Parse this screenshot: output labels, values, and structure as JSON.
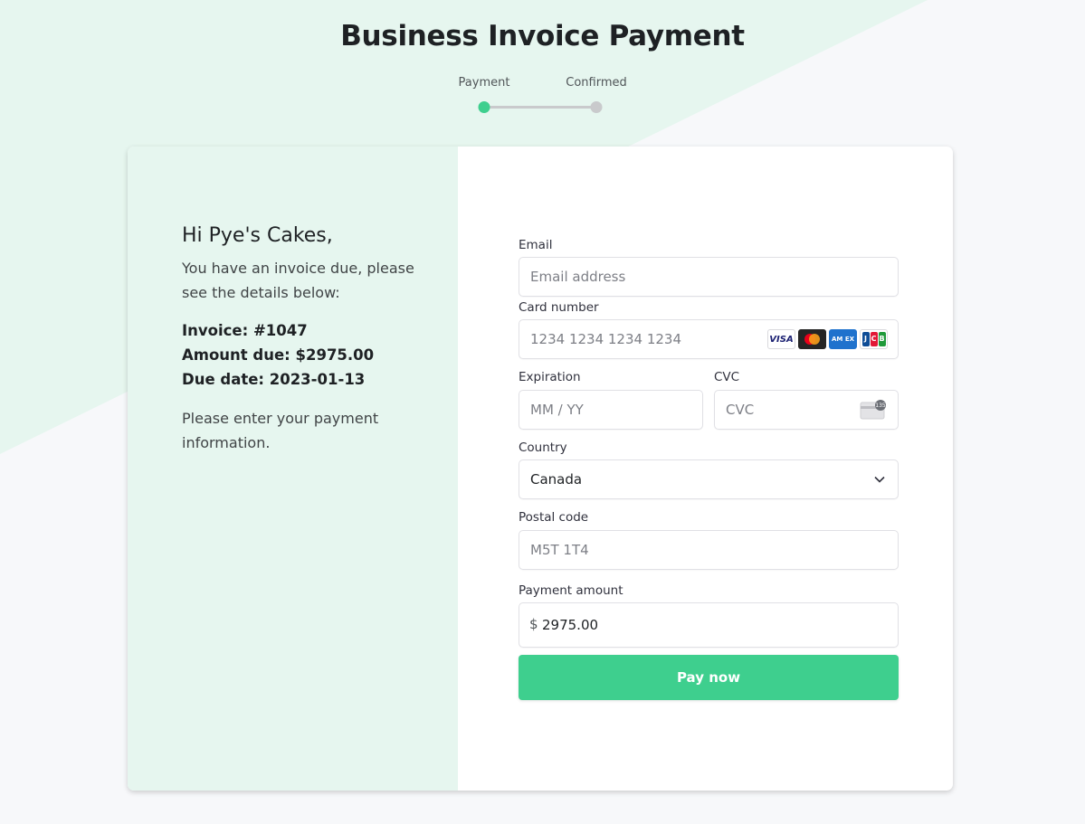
{
  "page": {
    "title": "Business Invoice Payment",
    "accent_color": "#3ecf8e"
  },
  "stepper": {
    "steps": [
      {
        "label": "Payment",
        "state": "active"
      },
      {
        "label": "Confirmed",
        "state": "inactive"
      }
    ]
  },
  "summary": {
    "greeting": "Hi Pye's Cakes,",
    "intro": "You have an invoice due, please see the details below:",
    "invoice": "Invoice: #1047",
    "amount_due": "Amount due: $2975.00",
    "due_date": "Due date: 2023-01-13",
    "outro": "Please enter your payment information."
  },
  "form": {
    "email": {
      "label": "Email",
      "value": "",
      "placeholder": "Email address"
    },
    "card_number": {
      "label": "Card number",
      "value": "",
      "placeholder": "1234 1234 1234 1234",
      "brands": [
        "visa-icon",
        "mastercard-icon",
        "amex-icon",
        "jcb-icon"
      ],
      "visa_text": "VISA",
      "amex_text": "AM EX",
      "jcb_letters": [
        "J",
        "C",
        "B"
      ]
    },
    "expiration": {
      "label": "Expiration",
      "value": "",
      "placeholder": "MM / YY"
    },
    "cvc": {
      "label": "CVC",
      "value": "",
      "placeholder": "CVC",
      "icon_text": "135"
    },
    "country": {
      "label": "Country",
      "selected": "Canada"
    },
    "postal_code": {
      "label": "Postal code",
      "value": "",
      "placeholder": "M5T 1T4"
    },
    "payment_amount": {
      "label": "Payment amount",
      "currency": "$",
      "value": "2975.00"
    },
    "submit_label": "Pay now"
  }
}
